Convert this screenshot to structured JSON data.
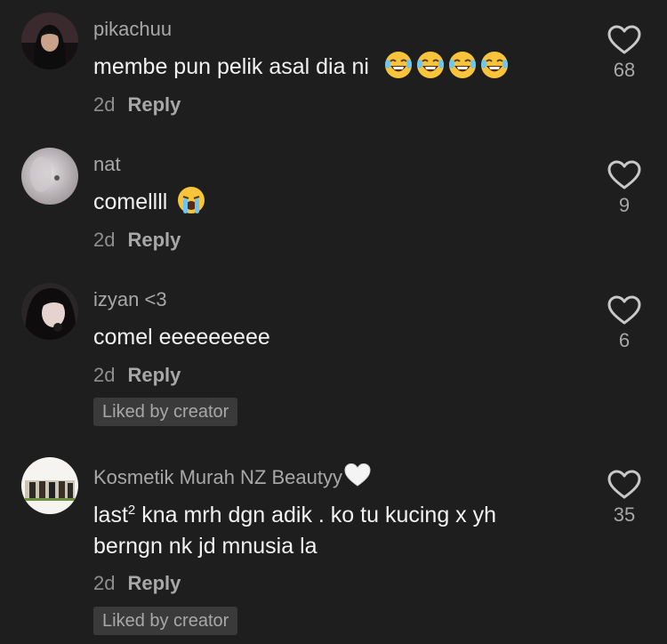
{
  "comments": [
    {
      "username": "pikachuu",
      "text": "membe pun pelik asal dia ni",
      "emoji": [
        "laughing-tears-emoji",
        "laughing-tears-emoji",
        "laughing-tears-emoji",
        "laughing-tears-emoji"
      ],
      "time": "2d",
      "reply": "Reply",
      "likes": "68"
    },
    {
      "username": "nat",
      "text": "comellll",
      "emoji": [
        "loudly-crying-emoji"
      ],
      "time": "2d",
      "reply": "Reply",
      "likes": "9"
    },
    {
      "username": "izyan <3",
      "text": "comel eeeeeeeee",
      "time": "2d",
      "reply": "Reply",
      "likes": "6",
      "liked_by": "Liked by creator"
    },
    {
      "username": "Kosmetik Murah NZ Beautyy",
      "username_emoji": "white-heart-emoji",
      "text_line1_a": "last",
      "text_line1_sup": "2",
      "text_line1_b": " kna mrh dgn adik . ko tu kucing x yh",
      "text_line2": "berngn nk jd mnusia la",
      "time": "2d",
      "reply": "Reply",
      "likes": "35",
      "liked_by": "Liked by creator"
    }
  ],
  "colors": {
    "background": "#1e1e1e",
    "username": "#a8a8a8",
    "text": "#f2f2f2",
    "meta": "#8e8e8e",
    "badge_bg": "#3a3a3a"
  }
}
